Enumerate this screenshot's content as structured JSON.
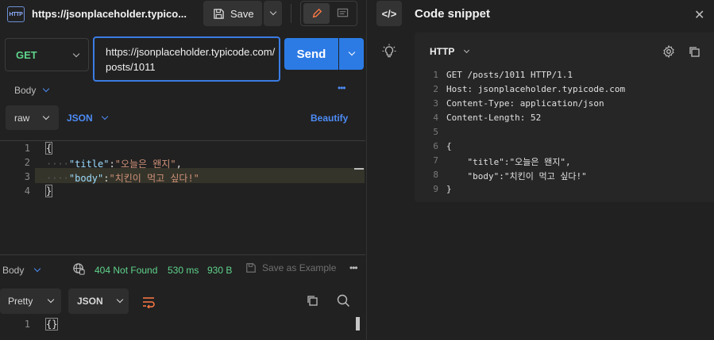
{
  "request": {
    "tab_title": "https://jsonplaceholder.typico...",
    "http_badge": "HTTP",
    "save_label": "Save",
    "method": "GET",
    "url": "https://jsonplaceholder.typicode.com/posts/1011",
    "send_label": "Send",
    "body_tab": "Body",
    "body_mode": "raw",
    "body_format": "JSON",
    "beautify_label": "Beautify",
    "more": "•••",
    "editor_lines": [
      {
        "num": "1",
        "text": "{"
      },
      {
        "num": "2",
        "ws": "····",
        "key": "\"title\"",
        "sep": ":",
        "val": "\"오늘은 왠지\"",
        "end": ","
      },
      {
        "num": "3",
        "ws": "····",
        "key": "\"body\"",
        "sep": ":",
        "val": "\"치킨이 먹고 싶다!\"",
        "end": ""
      },
      {
        "num": "4",
        "text": "}"
      }
    ]
  },
  "response": {
    "body_tab": "Body",
    "status": "404 Not Found",
    "time": "530 ms",
    "size": "930 B",
    "save_example": "Save as Example",
    "more": "•••",
    "view_mode": "Pretty",
    "format": "JSON",
    "lines": [
      {
        "num": "1",
        "text": "{}"
      }
    ]
  },
  "snippet": {
    "title": "Code snippet",
    "toggle_label": "</>",
    "language": "HTTP",
    "close": "✕",
    "lines": [
      {
        "num": "1",
        "text": "GET /posts/1011 HTTP/1.1"
      },
      {
        "num": "2",
        "text": "Host: jsonplaceholder.typicode.com"
      },
      {
        "num": "3",
        "text": "Content-Type: application/json"
      },
      {
        "num": "4",
        "text": "Content-Length: 52"
      },
      {
        "num": "5",
        "text": ""
      },
      {
        "num": "6",
        "text": "{"
      },
      {
        "num": "7",
        "text": "    \"title\":\"오늘은 왠지\","
      },
      {
        "num": "8",
        "text": "    \"body\":\"치킨이 먹고 싶다!\""
      },
      {
        "num": "9",
        "text": "}"
      }
    ]
  },
  "colors": {
    "accent": "#2c7be5",
    "success": "#5fd38c",
    "link": "#4d8cf5"
  }
}
